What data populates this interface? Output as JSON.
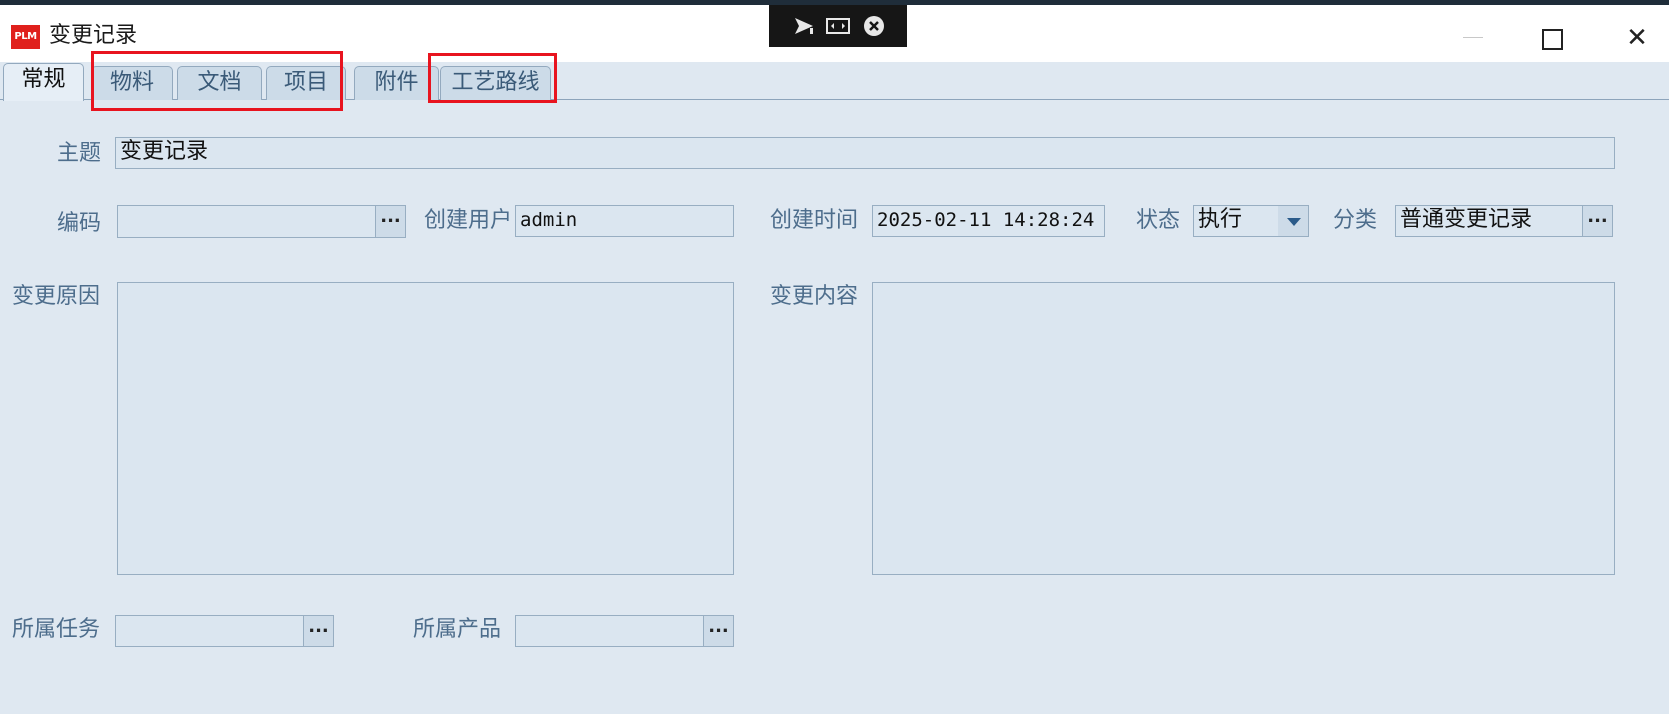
{
  "window": {
    "title": "变更记录",
    "app_icon_text": "PLM",
    "close_glyph": "✕"
  },
  "tabs": [
    {
      "label": "常规",
      "active": true
    },
    {
      "label": "物料",
      "active": false
    },
    {
      "label": "文档",
      "active": false
    },
    {
      "label": "项目",
      "active": false
    },
    {
      "label": "附件",
      "active": false
    },
    {
      "label": "工艺路线",
      "active": false
    }
  ],
  "form": {
    "subject": {
      "label": "主题",
      "value": "变更记录"
    },
    "code": {
      "label": "编码",
      "value": "",
      "button": "..."
    },
    "creator": {
      "label": "创建用户",
      "value": "admin"
    },
    "created_time": {
      "label": "创建时间",
      "value": "2025-02-11 14:28:24"
    },
    "status": {
      "label": "状态",
      "value": "执行"
    },
    "category": {
      "label": "分类",
      "value": "普通变更记录",
      "button": "..."
    },
    "reason": {
      "label": "变更原因",
      "value": ""
    },
    "content": {
      "label": "变更内容",
      "value": ""
    },
    "task": {
      "label": "所属任务",
      "value": "",
      "button": "..."
    },
    "product": {
      "label": "所属产品",
      "value": "",
      "button": "..."
    }
  },
  "icons": {
    "remote_send": "send-arrow-icon",
    "remote_resize": "resize-icon",
    "remote_close": "close-circle-icon"
  },
  "colors": {
    "highlight": "#e8141f",
    "app_icon": "#e0201c",
    "panel_bg": "#dfe8f1"
  }
}
